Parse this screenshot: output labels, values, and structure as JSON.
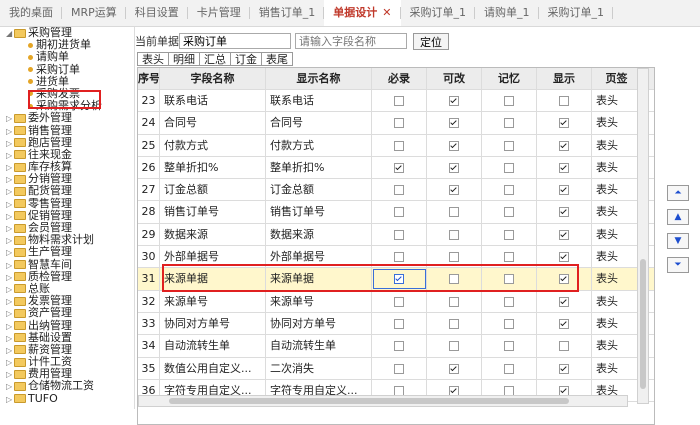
{
  "tabs": [
    "我的桌面",
    "MRP运算",
    "科目设置",
    "卡片管理",
    "销售订单_1",
    "单据设计",
    "采购订单_1",
    "请购单_1",
    "采购订单_1"
  ],
  "active_tab": 5,
  "tree": [
    {
      "label": "采购管理",
      "level": 0,
      "expanded": true
    },
    {
      "label": "期初进货单",
      "level": 1
    },
    {
      "label": "请购单",
      "level": 1
    },
    {
      "label": "采购订单",
      "level": 1
    },
    {
      "label": "进货单",
      "level": 1
    },
    {
      "label": "采购发票",
      "level": 1
    },
    {
      "label": "采购需求分析",
      "level": 1
    },
    {
      "label": "委外管理",
      "level": 0
    },
    {
      "label": "销售管理",
      "level": 0
    },
    {
      "label": "跑店管理",
      "level": 0
    },
    {
      "label": "往来现金",
      "level": 0
    },
    {
      "label": "库存核算",
      "level": 0
    },
    {
      "label": "分销管理",
      "level": 0
    },
    {
      "label": "配货管理",
      "level": 0
    },
    {
      "label": "零售管理",
      "level": 0
    },
    {
      "label": "促销管理",
      "level": 0
    },
    {
      "label": "会员管理",
      "level": 0
    },
    {
      "label": "物料需求计划",
      "level": 0
    },
    {
      "label": "生产管理",
      "level": 0
    },
    {
      "label": "智慧车间",
      "level": 0
    },
    {
      "label": "质检管理",
      "level": 0
    },
    {
      "label": "总账",
      "level": 0
    },
    {
      "label": "发票管理",
      "level": 0
    },
    {
      "label": "资产管理",
      "level": 0
    },
    {
      "label": "出纳管理",
      "level": 0
    },
    {
      "label": "基础设置",
      "level": 0
    },
    {
      "label": "薪资管理",
      "level": 0
    },
    {
      "label": "计件工资",
      "level": 0
    },
    {
      "label": "费用管理",
      "level": 0
    },
    {
      "label": "仓储物流工资",
      "level": 0
    },
    {
      "label": "TUFO",
      "level": 0
    }
  ],
  "form": {
    "current_label": "当前单据",
    "current_value": "采购订单",
    "search_placeholder": "请输入字段名称",
    "locate_button": "定位"
  },
  "subtabs": [
    "表头",
    "明细",
    "汇总",
    "订金",
    "表尾"
  ],
  "columns": [
    "序号",
    "字段名称",
    "显示名称",
    "必录",
    "可改",
    "记忆",
    "显示",
    "页签"
  ],
  "rows": [
    {
      "n": "23",
      "field": "联系电话",
      "display": "联系电话",
      "req": false,
      "edit": true,
      "mem": false,
      "show": false,
      "page": "表头"
    },
    {
      "n": "24",
      "field": "合同号",
      "display": "合同号",
      "req": false,
      "edit": true,
      "mem": false,
      "show": true,
      "page": "表头"
    },
    {
      "n": "25",
      "field": "付款方式",
      "display": "付款方式",
      "req": false,
      "edit": true,
      "mem": false,
      "show": true,
      "page": "表头"
    },
    {
      "n": "26",
      "field": "整单折扣%",
      "display": "整单折扣%",
      "req": true,
      "edit": true,
      "mem": false,
      "show": true,
      "page": "表头"
    },
    {
      "n": "27",
      "field": "订金总额",
      "display": "订金总额",
      "req": false,
      "edit": true,
      "mem": false,
      "show": true,
      "page": "表头"
    },
    {
      "n": "28",
      "field": "销售订单号",
      "display": "销售订单号",
      "req": false,
      "edit": false,
      "mem": false,
      "show": true,
      "page": "表头"
    },
    {
      "n": "29",
      "field": "数据来源",
      "display": "数据来源",
      "req": false,
      "edit": false,
      "mem": false,
      "show": true,
      "page": "表头"
    },
    {
      "n": "30",
      "field": "外部单据号",
      "display": "外部单据号",
      "req": false,
      "edit": false,
      "mem": false,
      "show": true,
      "page": "表头"
    },
    {
      "n": "31",
      "field": "来源单据",
      "display": "来源单据",
      "req": true,
      "edit": false,
      "mem": false,
      "show": true,
      "page": "表头",
      "selected": true
    },
    {
      "n": "32",
      "field": "来源单号",
      "display": "来源单号",
      "req": false,
      "edit": false,
      "mem": false,
      "show": true,
      "page": "表头"
    },
    {
      "n": "33",
      "field": "协同对方单号",
      "display": "协同对方单号",
      "req": false,
      "edit": false,
      "mem": false,
      "show": true,
      "page": "表头"
    },
    {
      "n": "34",
      "field": "自动流转生单",
      "display": "自动流转生单",
      "req": false,
      "edit": false,
      "mem": false,
      "show": false,
      "page": "表头"
    },
    {
      "n": "35",
      "field": "数值公用自定义...",
      "display": "二次消失",
      "req": false,
      "edit": true,
      "mem": false,
      "show": true,
      "page": "表头"
    },
    {
      "n": "36",
      "field": "字符专用自定义...",
      "display": "字符专用自定义...",
      "req": false,
      "edit": true,
      "mem": false,
      "show": true,
      "page": "表头"
    }
  ],
  "nav_buttons": [
    "⏶",
    "▲",
    "▼",
    "⏷"
  ]
}
